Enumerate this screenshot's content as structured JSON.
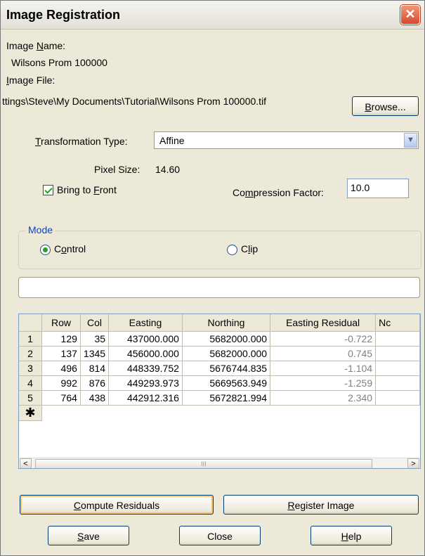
{
  "window": {
    "title": "Image Registration",
    "close_glyph": "✕"
  },
  "image_name": {
    "label_pre": "Image ",
    "label_mnemonic": "N",
    "label_post": "ame:",
    "value": "Wilsons Prom 100000"
  },
  "image_file": {
    "label_mnemonic": "I",
    "label_post": "mage File:",
    "value": "ttings\\Steve\\My Documents\\Tutorial\\Wilsons Prom 100000.tif"
  },
  "browse": {
    "mnemonic": "B",
    "post": "rowse..."
  },
  "transformation": {
    "label_mnemonic": "T",
    "label_post": "ransformation Type:",
    "value": "Affine"
  },
  "pixel_size": {
    "label": "Pixel Size:",
    "value": "14.60"
  },
  "bring_to_front": {
    "label_pre": "Bring to ",
    "label_mnemonic": "F",
    "label_post": "ront",
    "checked": true
  },
  "compression": {
    "label_pre": "Co",
    "label_mnemonic": "m",
    "label_post": "pression Factor:",
    "value": "10.0"
  },
  "mode": {
    "label": "Mode",
    "control": {
      "pre": "C",
      "mnemonic": "o",
      "post": "ntrol",
      "selected": true
    },
    "clip": {
      "pre": "C",
      "mnemonic": "l",
      "post": "ip",
      "selected": false
    }
  },
  "status_text": "",
  "grid": {
    "headers": [
      "",
      "Row",
      "Col",
      "Easting",
      "Northing",
      "Easting Residual",
      "Nc"
    ],
    "rows": [
      [
        "1",
        "129",
        "35",
        "437000.000",
        "5682000.000",
        "-0.722"
      ],
      [
        "2",
        "137",
        "1345",
        "456000.000",
        "5682000.000",
        "0.745"
      ],
      [
        "3",
        "496",
        "814",
        "448339.752",
        "5676744.835",
        "-1.104"
      ],
      [
        "4",
        "992",
        "876",
        "449293.973",
        "5669563.949",
        "-1.259"
      ],
      [
        "5",
        "764",
        "438",
        "442912.316",
        "5672821.994",
        "2.340"
      ]
    ],
    "new_row_glyph": "✱",
    "scroll_left": "<",
    "scroll_right": ">",
    "thumb_grip": "III"
  },
  "buttons": {
    "compute": {
      "mnemonic": "C",
      "post": "ompute Residuals"
    },
    "register": {
      "mnemonic": "R",
      "post": "egister Image"
    },
    "save": {
      "mnemonic": "S",
      "post": "ave"
    },
    "close": {
      "label": "Close"
    },
    "help": {
      "mnemonic": "H",
      "post": "elp"
    }
  }
}
